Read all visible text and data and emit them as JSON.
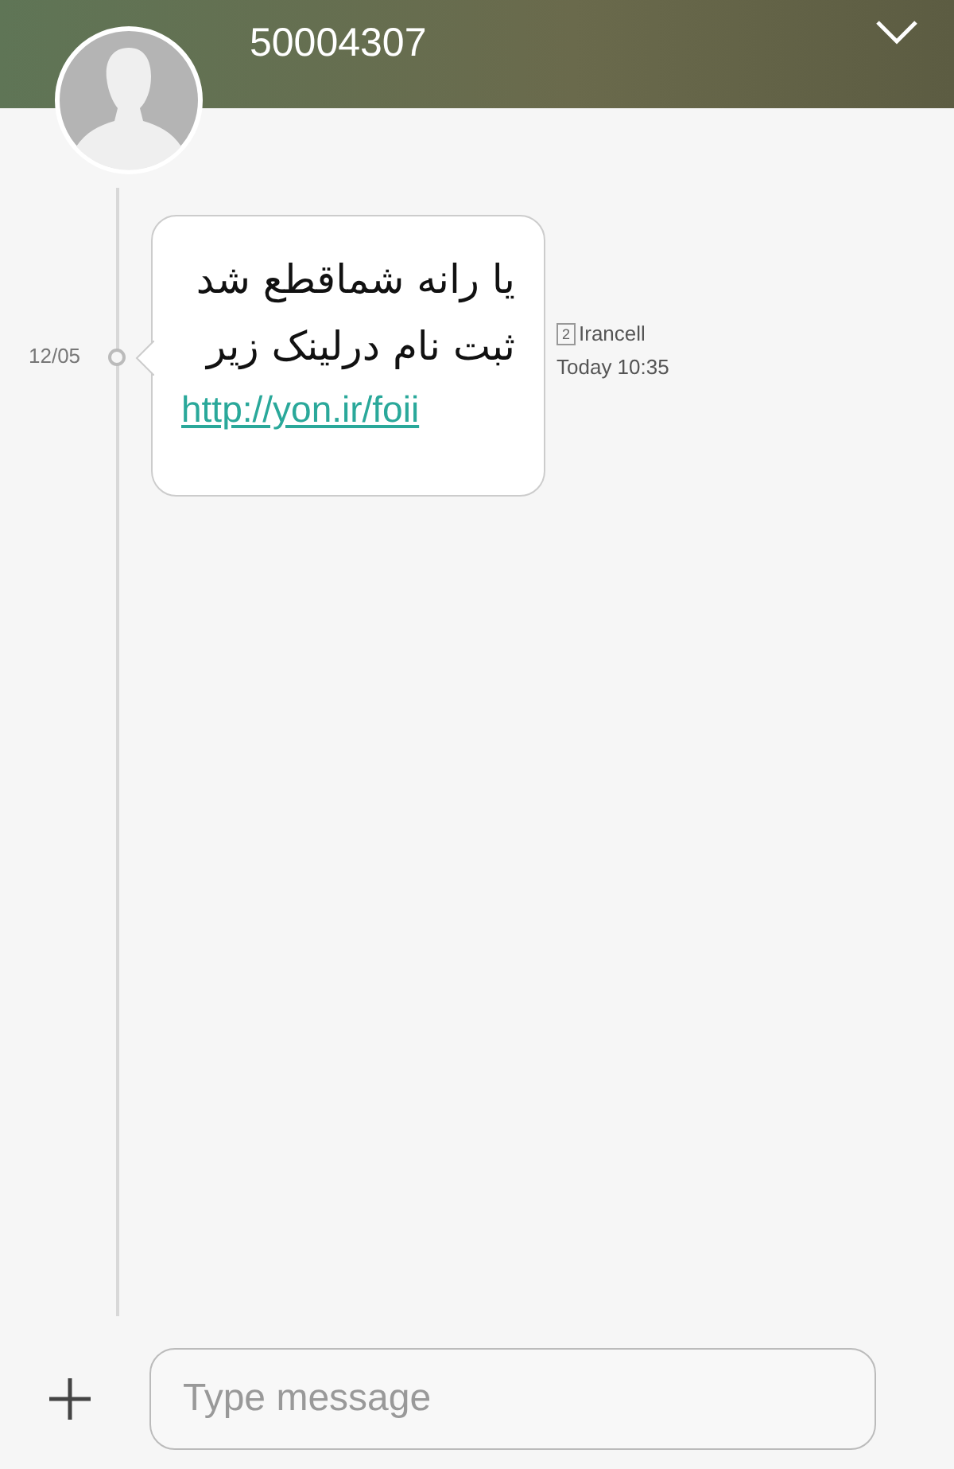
{
  "header": {
    "title": "50004307"
  },
  "messages": [
    {
      "date": "12/05",
      "lines": [
        "یا رانه شماقطع شد",
        "ثبت نام درلینک زیر"
      ],
      "link": "http://yon.ir/foii",
      "sim_slot": "2",
      "sender": "Irancell",
      "time": "Today 10:35"
    }
  ],
  "composer": {
    "placeholder": "Type message"
  }
}
